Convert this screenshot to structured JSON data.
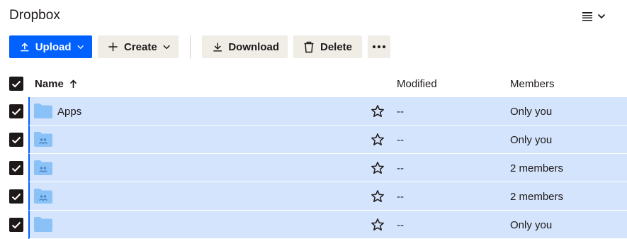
{
  "app": {
    "title": "Dropbox"
  },
  "toolbar": {
    "upload_label": "Upload",
    "create_label": "Create",
    "download_label": "Download",
    "delete_label": "Delete"
  },
  "table": {
    "columns": {
      "name": "Name",
      "modified": "Modified",
      "members": "Members"
    },
    "sort": "Name ascending",
    "rows": [
      {
        "name": "Apps",
        "icon": "folder-icon",
        "modified": "--",
        "members": "Only you",
        "selected": true
      },
      {
        "name": "",
        "icon": "shared-folder-icon",
        "modified": "--",
        "members": "Only you",
        "selected": true
      },
      {
        "name": "",
        "icon": "shared-folder-icon",
        "modified": "--",
        "members": "2 members",
        "selected": true
      },
      {
        "name": "",
        "icon": "shared-folder-icon",
        "modified": "--",
        "members": "2 members",
        "selected": true
      },
      {
        "name": "",
        "icon": "folder-icon",
        "modified": "--",
        "members": "Only you",
        "selected": true
      }
    ]
  },
  "colors": {
    "accent": "#0061fe",
    "selected_row": "#d4e4fc",
    "folder": "#8ac2f7",
    "secondary_button": "#f0ece6"
  }
}
